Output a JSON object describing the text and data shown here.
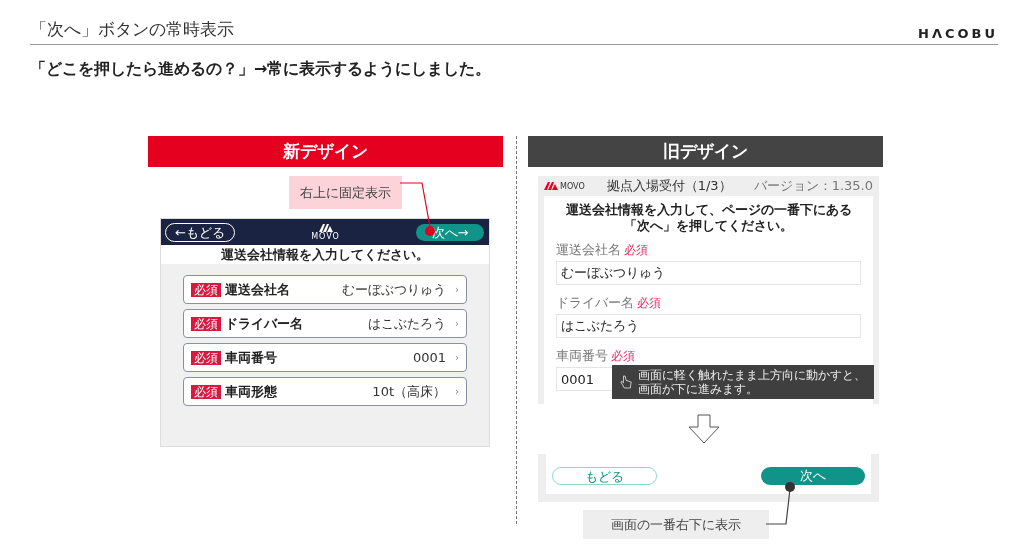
{
  "header": {
    "title": "「次へ」ボタンの常時表示",
    "logo": "HΛCOBU"
  },
  "subtitle": "「どこを押したら進めるの？」→常に表示するようにしました。",
  "new_design": {
    "heading": "新デザイン",
    "callout": "右上に固定表示",
    "nav": {
      "back": "←もどる",
      "brand": "MOVO",
      "next": "次へ→"
    },
    "instruction": "運送会社情報を入力してください。",
    "fields": [
      {
        "badge": "必須",
        "label": "運送会社名",
        "value": "むーぼぶつりゅう",
        "chevron": "›"
      },
      {
        "badge": "必須",
        "label": "ドライバー名",
        "value": "はこぶたろう",
        "chevron": "›"
      },
      {
        "badge": "必須",
        "label": "車両番号",
        "value": "0001",
        "chevron": "›"
      },
      {
        "badge": "必須",
        "label": "車両形態",
        "value": "10t（高床）",
        "chevron": "›"
      }
    ]
  },
  "old_design": {
    "heading": "旧デザイン",
    "topbar": {
      "brand": "MOVO",
      "title": "拠点入場受付（1/3）",
      "version": "バージョン：1.35.0"
    },
    "instruction": [
      "運送会社情報を入力して、ページの一番下にある",
      "「次へ」を押してください。"
    ],
    "fields": [
      {
        "label": "運送会社名",
        "required": "必須",
        "value": "むーぼぶつりゅう"
      },
      {
        "label": "ドライバー名",
        "required": "必須",
        "value": "はこぶたろう"
      },
      {
        "label": "車両番号",
        "required": "必須",
        "value": "0001"
      }
    ],
    "tooltip": [
      "画面に軽く触れたまま上方向に動かすと、",
      "画面が下に進みます。"
    ],
    "footer": {
      "back": "もどる",
      "next": "次へ"
    },
    "callout": "画面の一番右下に表示"
  }
}
